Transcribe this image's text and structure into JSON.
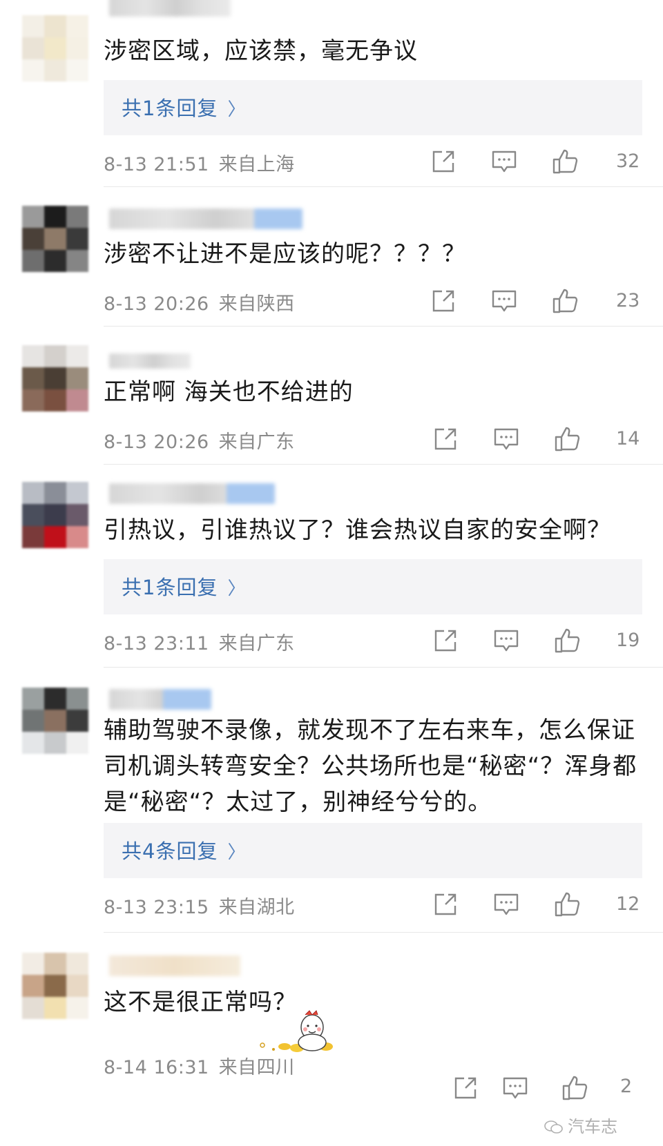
{
  "comments": [
    {
      "text": "涉密区域，应该禁，毫无争议",
      "reply_label": "共1条回复",
      "date": "8-13 21:51",
      "location": "来自上海",
      "likes": "32"
    },
    {
      "text": "涉密不让进不是应该的呢？？？？",
      "reply_label": "",
      "date": "8-13 20:26",
      "location": "来自陕西",
      "likes": "23"
    },
    {
      "text": "正常啊 海关也不给进的",
      "reply_label": "",
      "date": "8-13 20:26",
      "location": "来自广东",
      "likes": "14"
    },
    {
      "text": "引热议，引谁热议了？谁会热议自家的安全啊？",
      "reply_label": "共1条回复",
      "date": "8-13 23:11",
      "location": "来自广东",
      "likes": "19"
    },
    {
      "text": "辅助驾驶不录像，就发现不了左右来车，怎么保证司机调头转弯安全？公共场所也是“秘密“？浑身都是“秘密“？太过了，别神经兮兮的。",
      "reply_label": "共4条回复",
      "date": "8-13 23:15",
      "location": "来自湖北",
      "likes": "12"
    },
    {
      "text": "这不是很正常吗？",
      "reply_label": "",
      "date": "8-14 16:31",
      "location": "来自四川",
      "likes": "2"
    }
  ],
  "icons": {
    "share": "share-icon",
    "comment": "comment-icon",
    "like": "thumbs-up-icon",
    "chevron": "chevron-right-icon"
  },
  "watermark": {
    "text": "汽车志"
  },
  "colors": {
    "link": "#3a6fb0",
    "meta": "#8a8a8a",
    "reply_bg": "#f4f4f6"
  }
}
